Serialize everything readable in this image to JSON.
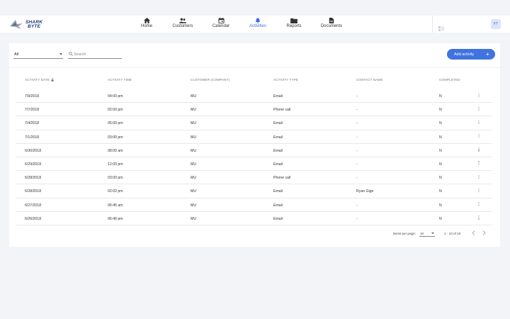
{
  "brand": {
    "logo_line1": "SHARK",
    "logo_line2": "BYTE"
  },
  "nav": [
    {
      "label": "Home",
      "icon": "home-icon"
    },
    {
      "label": "Customers",
      "icon": "people-icon"
    },
    {
      "label": "Calendar",
      "icon": "calendar-icon"
    },
    {
      "label": "Activities",
      "icon": "bell-icon",
      "active": true
    },
    {
      "label": "Reports",
      "icon": "folder-icon"
    },
    {
      "label": "Documents",
      "icon": "document-icon"
    }
  ],
  "user": {
    "initials": "FT"
  },
  "toolbar": {
    "filter_value": "All",
    "search_placeholder": "Search",
    "add_label": "Add activity",
    "add_symbol": "+"
  },
  "table": {
    "columns": [
      "ACTIVITY DATE",
      "ACTIVITY TIME",
      "CUSTOMER (COMPANY)",
      "ACTIVITY TYPE",
      "CONTACT NAME",
      "COMPLETED"
    ],
    "sort_column": "ACTIVITY DATE",
    "rows": [
      [
        "7/9/2018",
        "04:00 pm",
        "MU",
        "Email",
        "-",
        "N"
      ],
      [
        "7/7/2018",
        "02:00 pm",
        "MU",
        "Phone call",
        "-",
        "N"
      ],
      [
        "7/4/2018",
        "05:00 pm",
        "MU",
        "Email",
        "-",
        "N"
      ],
      [
        "7/1/2018",
        "03:00 pm",
        "MU",
        "Email",
        "-",
        "N"
      ],
      [
        "6/30/2018",
        "08:00 am",
        "MU",
        "Email",
        "-",
        "N"
      ],
      [
        "6/29/2018",
        "12:00 pm",
        "MU",
        "Email",
        "-",
        "N"
      ],
      [
        "6/28/2018",
        "03:00 pm",
        "MU",
        "Phone call",
        "-",
        "N"
      ],
      [
        "6/28/2018",
        "02:02 pm",
        "MU",
        "Email",
        "Ryan Gigs",
        "N"
      ],
      [
        "6/27/2018",
        "06:45 am",
        "MU",
        "Email",
        "-",
        "N"
      ],
      [
        "6/26/2018",
        "06:46 pm",
        "MU",
        "Email",
        "-",
        "N"
      ]
    ]
  },
  "pagination": {
    "items_per_page_label": "Items per page:",
    "items_per_page": "10",
    "range": "1 - 10 of 10"
  },
  "colors": {
    "accent": "#4173e0",
    "background": "#f3f4f8",
    "active_nav": "#3f6fdc"
  }
}
